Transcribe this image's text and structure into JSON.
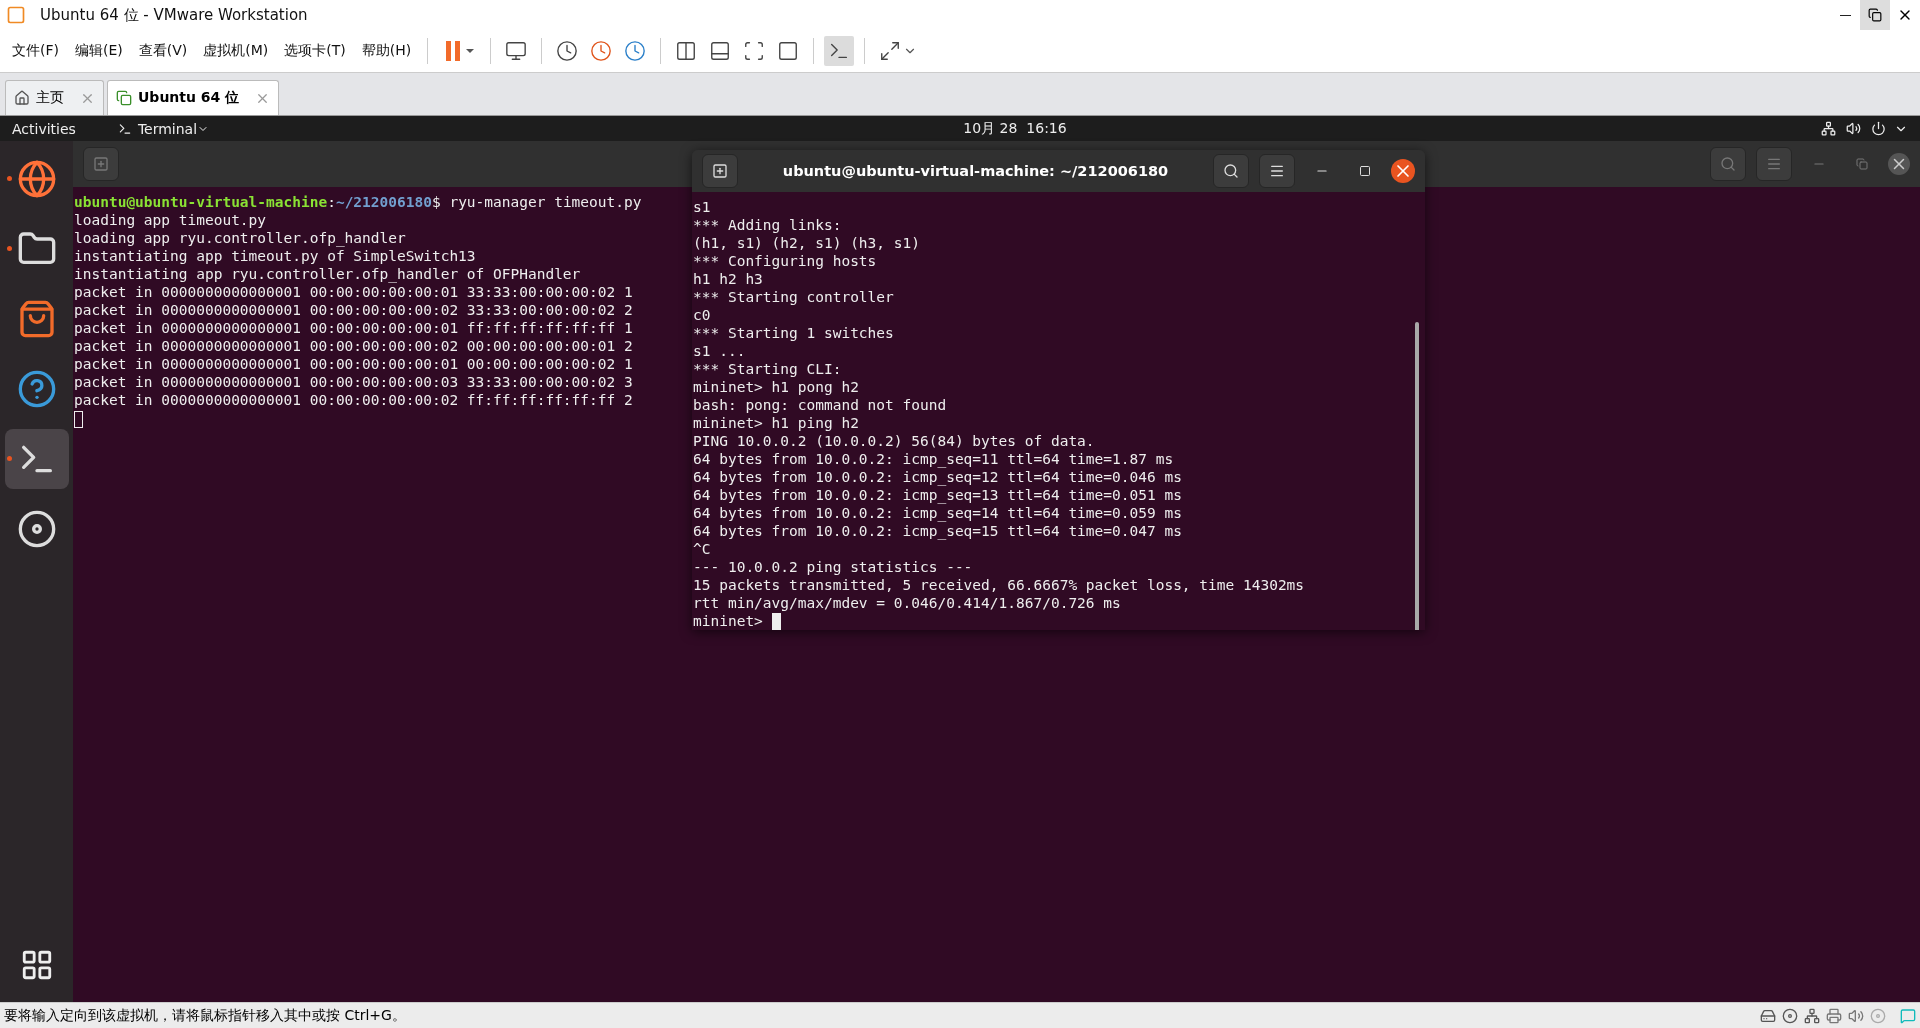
{
  "window": {
    "title": "Ubuntu 64 位 - VMware Workstation"
  },
  "menu": [
    "文件(F)",
    "编辑(E)",
    "查看(V)",
    "虚拟机(M)",
    "选项卡(T)",
    "帮助(H)"
  ],
  "tabs": [
    {
      "label": "主页",
      "kind": "home",
      "selected": false
    },
    {
      "label": "Ubuntu 64 位",
      "kind": "vm",
      "selected": true
    }
  ],
  "topbar": {
    "activities": "Activities",
    "app": "Terminal",
    "clock": "10月 28  16:16"
  },
  "dock": [
    {
      "kind": "browser",
      "running": true,
      "selected": false
    },
    {
      "kind": "files",
      "running": true,
      "selected": false
    },
    {
      "kind": "store",
      "running": false,
      "selected": false
    },
    {
      "kind": "help",
      "running": false,
      "selected": false
    },
    {
      "kind": "terminal",
      "running": true,
      "selected": true
    },
    {
      "kind": "disc",
      "running": false,
      "selected": false
    }
  ],
  "back_terminal": {
    "lines": [
      {
        "kind": "prompt",
        "user": "ubuntu@ubuntu-virtual-machine",
        "separator": ":",
        "path": "~/212006180",
        "text": "$ ryu-manager timeout.py"
      },
      {
        "kind": "output",
        "text": "loading app timeout.py"
      },
      {
        "kind": "output",
        "text": "loading app ryu.controller.ofp_handler"
      },
      {
        "kind": "output",
        "text": "instantiating app timeout.py of SimpleSwitch13"
      },
      {
        "kind": "output",
        "text": "instantiating app ryu.controller.ofp_handler of OFPHandler"
      },
      {
        "kind": "output",
        "text": "packet in 0000000000000001 00:00:00:00:00:01 33:33:00:00:00:02 1"
      },
      {
        "kind": "output",
        "text": "packet in 0000000000000001 00:00:00:00:00:02 33:33:00:00:00:02 2"
      },
      {
        "kind": "output",
        "text": "packet in 0000000000000001 00:00:00:00:00:01 ff:ff:ff:ff:ff:ff 1"
      },
      {
        "kind": "output",
        "text": "packet in 0000000000000001 00:00:00:00:00:02 00:00:00:00:00:01 2"
      },
      {
        "kind": "output",
        "text": "packet in 0000000000000001 00:00:00:00:00:01 00:00:00:00:00:02 1"
      },
      {
        "kind": "output",
        "text": "packet in 0000000000000001 00:00:00:00:00:03 33:33:00:00:00:02 3"
      },
      {
        "kind": "output",
        "text": "packet in 0000000000000001 00:00:00:00:00:02 ff:ff:ff:ff:ff:ff 2"
      }
    ]
  },
  "front_terminal": {
    "title": "ubuntu@ubuntu-virtual-machine: ~/212006180",
    "lines": [
      {
        "kind": "output",
        "text": "s1"
      },
      {
        "kind": "output",
        "text": "*** Adding links:"
      },
      {
        "kind": "output",
        "text": "(h1, s1) (h2, s1) (h3, s1)"
      },
      {
        "kind": "output",
        "text": "*** Configuring hosts"
      },
      {
        "kind": "output",
        "text": "h1 h2 h3"
      },
      {
        "kind": "output",
        "text": "*** Starting controller"
      },
      {
        "kind": "output",
        "text": "c0"
      },
      {
        "kind": "output",
        "text": "*** Starting 1 switches"
      },
      {
        "kind": "output",
        "text": "s1 ..."
      },
      {
        "kind": "output",
        "text": "*** Starting CLI:"
      },
      {
        "kind": "output",
        "text": "mininet> h1 pong h2"
      },
      {
        "kind": "output",
        "text": "bash: pong: command not found"
      },
      {
        "kind": "output",
        "text": "mininet> h1 ping h2"
      },
      {
        "kind": "output",
        "text": "PING 10.0.0.2 (10.0.0.2) 56(84) bytes of data."
      },
      {
        "kind": "output",
        "text": "64 bytes from 10.0.0.2: icmp_seq=11 ttl=64 time=1.87 ms"
      },
      {
        "kind": "output",
        "text": "64 bytes from 10.0.0.2: icmp_seq=12 ttl=64 time=0.046 ms"
      },
      {
        "kind": "output",
        "text": "64 bytes from 10.0.0.2: icmp_seq=13 ttl=64 time=0.051 ms"
      },
      {
        "kind": "output",
        "text": "64 bytes from 10.0.0.2: icmp_seq=14 ttl=64 time=0.059 ms"
      },
      {
        "kind": "output",
        "text": "64 bytes from 10.0.0.2: icmp_seq=15 ttl=64 time=0.047 ms"
      },
      {
        "kind": "output",
        "text": "^C"
      },
      {
        "kind": "output",
        "text": "--- 10.0.0.2 ping statistics ---"
      },
      {
        "kind": "output",
        "text": "15 packets transmitted, 5 received, 66.6667% packet loss, time 14302ms"
      },
      {
        "kind": "output",
        "text": "rtt min/avg/max/mdev = 0.046/0.414/1.867/0.726 ms"
      },
      {
        "kind": "cursor",
        "text": "mininet>"
      }
    ]
  },
  "status_bar": {
    "message": "要将输入定向到该虚拟机，请将鼠标指针移入其中或按 Ctrl+G。"
  }
}
